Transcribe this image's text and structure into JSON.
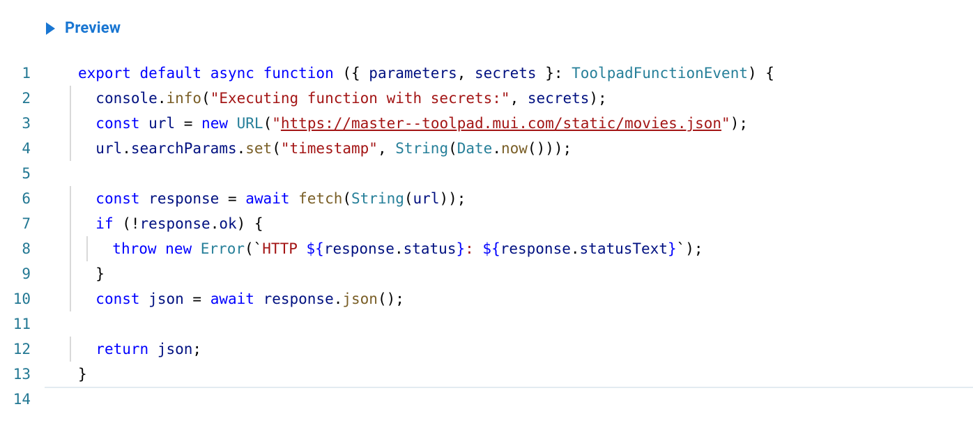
{
  "preview": {
    "label": "Preview"
  },
  "lines": {
    "1": "1",
    "2": "2",
    "3": "3",
    "4": "4",
    "5": "5",
    "6": "6",
    "7": "7",
    "8": "8",
    "9": "9",
    "10": "10",
    "11": "11",
    "12": "12",
    "13": "13",
    "14": "14"
  },
  "code": {
    "l1": {
      "export": "export",
      "default": "default",
      "async": "async",
      "function": "function",
      "paren1": " ({ ",
      "p1": "parameters",
      "comma": ", ",
      "p2": "secrets",
      "paren2": " }: ",
      "type": "ToolpadFunctionEvent",
      "paren3": ") {"
    },
    "l2": {
      "console": "console",
      "dot": ".",
      "info": "info",
      "open": "(",
      "str": "\"Executing function with secrets:\"",
      "comma": ", ",
      "secrets": "secrets",
      "close": ");"
    },
    "l3": {
      "const": "const",
      "url": "url",
      "eq": " = ",
      "new": "new",
      "URL": "URL",
      "open": "(",
      "strq1": "\"",
      "str": "https://master--toolpad.mui.com/static/movies.json",
      "strq2": "\"",
      "close": ");"
    },
    "l4": {
      "url": "url",
      "dot1": ".",
      "searchParams": "searchParams",
      "dot2": ".",
      "set": "set",
      "open": "(",
      "str": "\"timestamp\"",
      "comma": ", ",
      "String": "String",
      "open2": "(",
      "Date": "Date",
      "dot3": ".",
      "now": "now",
      "close": "()));"
    },
    "l6": {
      "const": "const",
      "response": "response",
      "eq": " = ",
      "await": "await",
      "fetch": "fetch",
      "open": "(",
      "String": "String",
      "open2": "(",
      "url": "url",
      "close": "));"
    },
    "l7": {
      "if": "if",
      "open": " (!",
      "response": "response",
      "dot": ".",
      "ok": "ok",
      "close": ") {"
    },
    "l8": {
      "throw": "throw",
      "new": "new",
      "Error": "Error",
      "open": "(`",
      "s1": "HTTP ",
      "dl1": "${",
      "response1": "response",
      "dot1": ".",
      "status": "status",
      "dr1": "}",
      "s2": ": ",
      "dl2": "${",
      "response2": "response",
      "dot2": ".",
      "statusText": "statusText",
      "dr2": "}",
      "close": "`);"
    },
    "l9": {
      "brace": "}"
    },
    "l10": {
      "const": "const",
      "json": "json",
      "eq": " = ",
      "await": "await",
      "response": "response",
      "dot": ".",
      "jsonfn": "json",
      "close": "();"
    },
    "l12": {
      "return": "return",
      "json": "json",
      "semi": ";"
    },
    "l13": {
      "brace": "}"
    }
  }
}
